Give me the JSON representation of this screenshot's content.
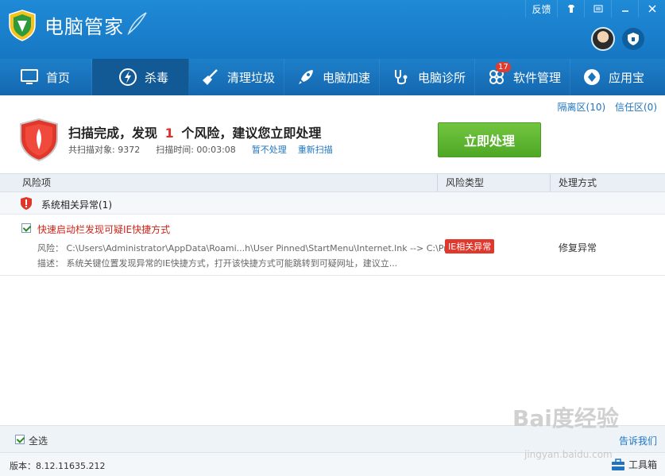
{
  "app": {
    "title": "电脑管家",
    "top_links": {
      "feedback": "反馈"
    }
  },
  "nav": {
    "items": [
      {
        "label": "首页"
      },
      {
        "label": "杀毒"
      },
      {
        "label": "清理垃圾"
      },
      {
        "label": "电脑加速"
      },
      {
        "label": "电脑诊所"
      },
      {
        "label": "软件管理",
        "badge": "17"
      },
      {
        "label": "应用宝"
      }
    ]
  },
  "links": {
    "quarantine": "隔离区(10)",
    "trust": "信任区(0)"
  },
  "summary": {
    "title_pre": "扫描完成，发现",
    "risk_count": "1",
    "title_post": "个风险，建议您立即处理",
    "scanned_objects": "共扫描对象: 9372",
    "scan_time": "扫描时间: 00:03:08",
    "skip": "暂不处理",
    "rescan": "重新扫描",
    "action_button": "立即处理"
  },
  "table": {
    "headers": [
      "风险项",
      "风险类型",
      "处理方式"
    ],
    "group": "系统相关异常(1)",
    "item": {
      "title": "快速启动栏发现可疑IE快捷方式",
      "risk_label": "风险：",
      "risk_value": "C:\\Users\\Administrator\\AppData\\Roami...h\\User Pinned\\StartMenu\\Internet.lnk --> C:\\Progra...",
      "desc_label": "描述：",
      "desc_value": "系统关键位置发现异常的IE快捷方式，打开该快捷方式可能跳转到可疑网址，建议立...",
      "risk_type": "IE相关异常",
      "action": "修复异常"
    }
  },
  "bottom": {
    "select_all": "全选",
    "tell_us": "告诉我们"
  },
  "status": {
    "version": "版本：8.12.11635.212",
    "toolbox": "工具箱"
  },
  "watermark": {
    "main": "Bai度经验",
    "sub": "jingyan.baidu.com"
  },
  "colors": {
    "accent": "#1e7fc9",
    "danger": "#e0302a",
    "success": "#5cb531"
  }
}
